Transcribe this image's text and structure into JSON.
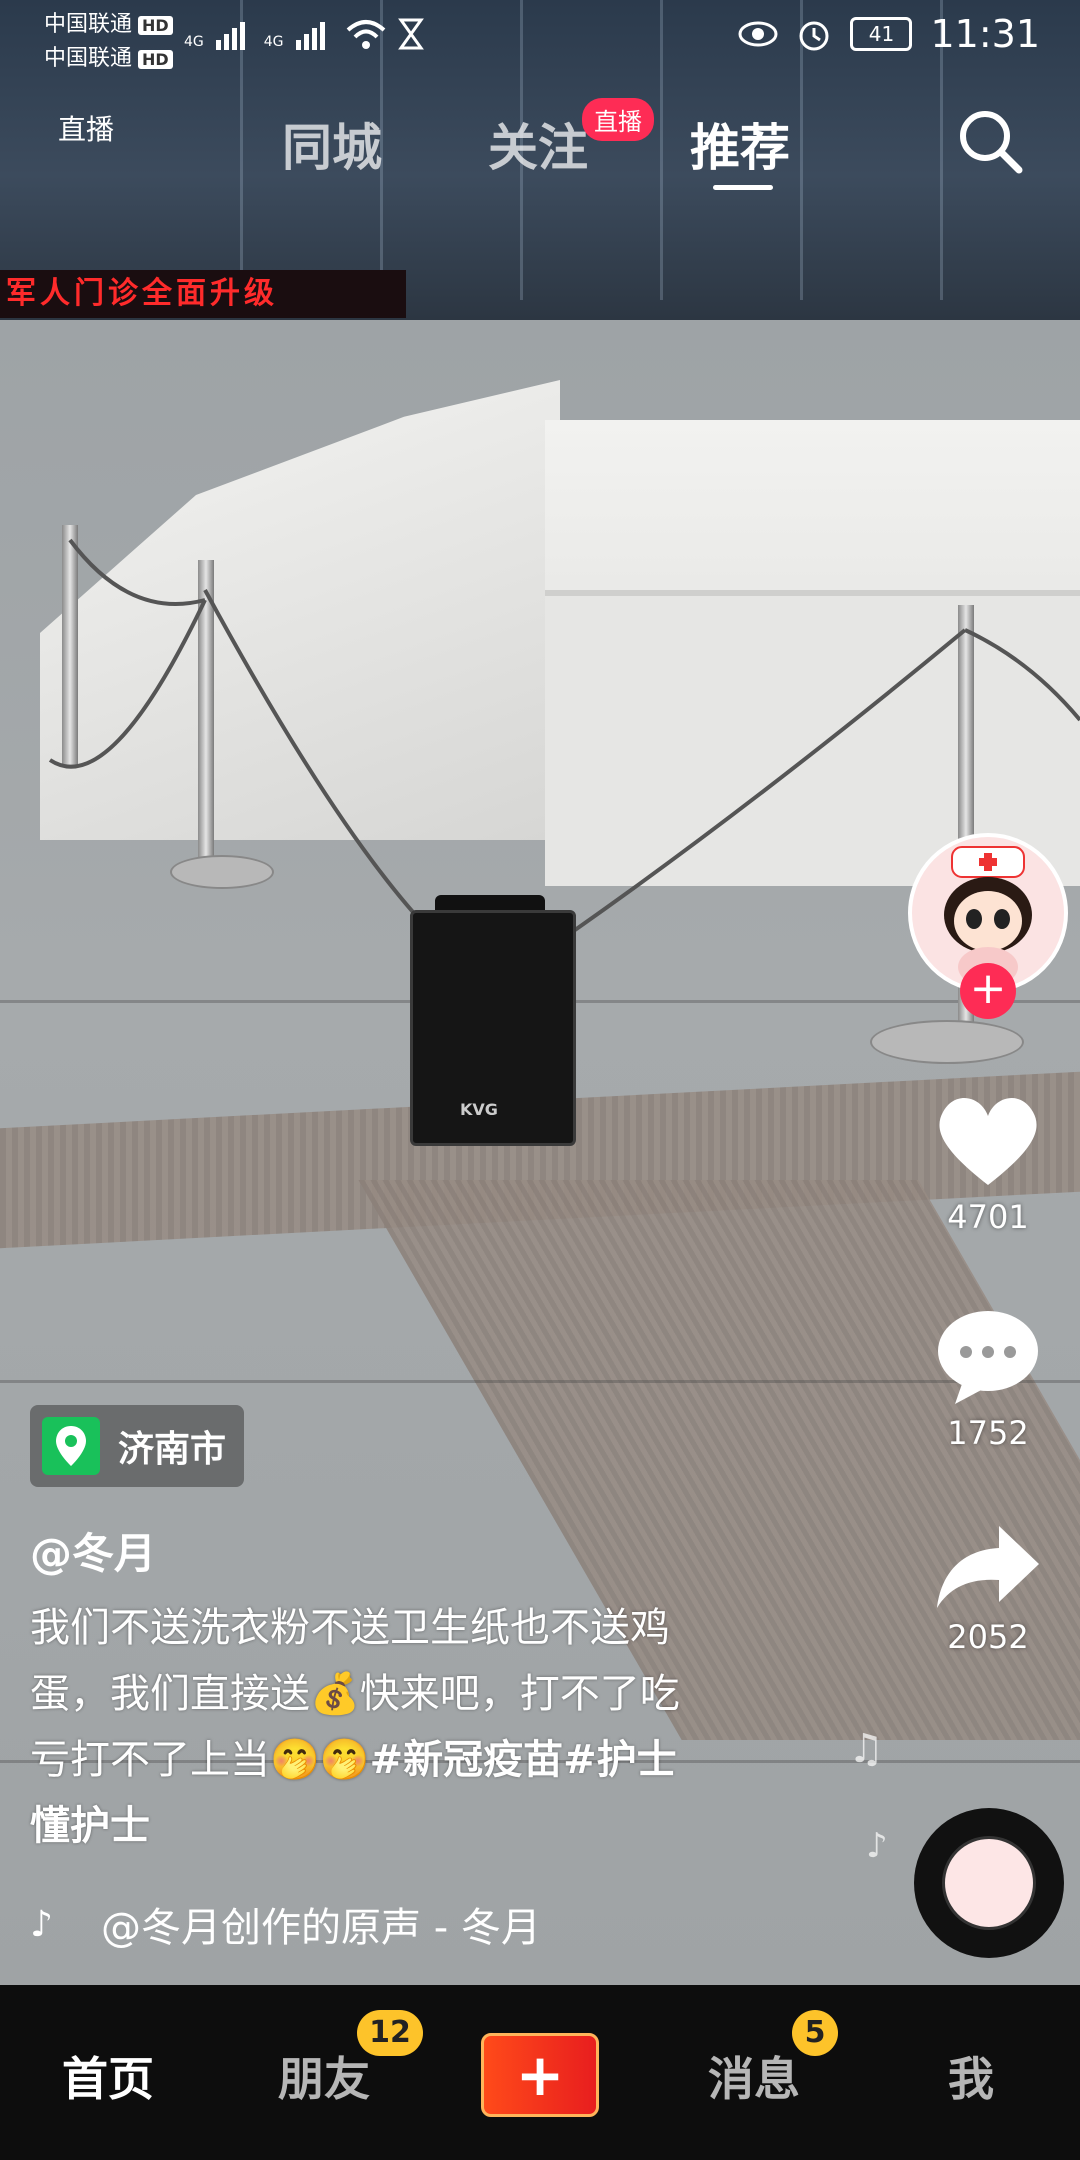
{
  "status_bar": {
    "carrier1": "中国联通",
    "carrier2": "中国联通",
    "hd": "HD",
    "net": "4G",
    "battery": "41",
    "time": "11:31"
  },
  "top_tabs": {
    "live_entry": "直播",
    "tab_city": "同城",
    "tab_follow": "关注",
    "follow_badge": "直播",
    "tab_recommend": "推荐"
  },
  "actions": {
    "likes": "4701",
    "comments": "1752",
    "shares": "2052"
  },
  "post": {
    "location": "济南市",
    "author": "@冬月",
    "description_line1": "我们不送洗衣粉不送卫生纸也不送鸡",
    "description_line2a": "蛋，我们直接送",
    "money_emoji": "💰",
    "description_line2b": "快来吧，打不了吃",
    "description_line3a": "亏打不了上当",
    "emoji": "🤭🤭",
    "hashtags_line3": "#新冠疫苗#护士",
    "hashtags_line4": "懂护士",
    "music": "@冬月创作的原声 - 冬月"
  },
  "scene_text": {
    "banner": "军人门诊全面升级",
    "speaker_brand": "KVG"
  },
  "bottom_nav": {
    "home": "首页",
    "friends": "朋友",
    "friends_badge": "12",
    "plus": "+",
    "messages": "消息",
    "messages_badge": "5",
    "me": "我"
  },
  "colors": {
    "accent_red": "#fe2c55",
    "badge_yellow": "#fdc32a",
    "location_green": "#19c15a"
  }
}
